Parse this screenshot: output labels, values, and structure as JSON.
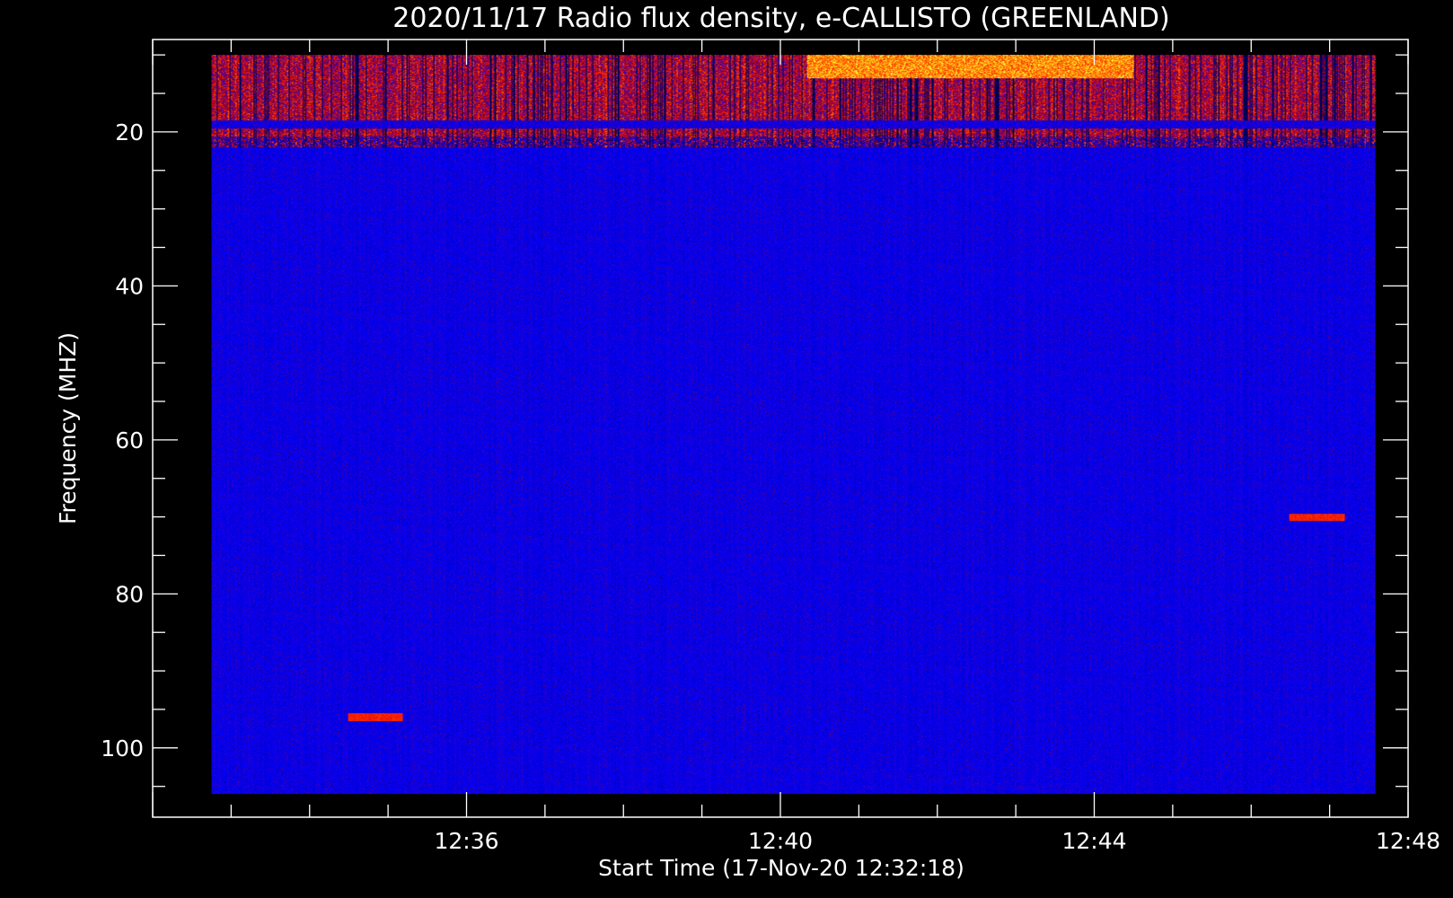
{
  "chart_data": {
    "type": "heatmap",
    "title": "2020/11/17  Radio flux density, e-CALLISTO (GREENLAND)",
    "xlabel": "Start Time (17-Nov-20 12:32:18)",
    "ylabel": "Frequency (MHZ)",
    "x_axis": {
      "unit": "minutes",
      "start_time": "12:32:18",
      "range": [
        "12:32:00",
        "12:48:00"
      ],
      "data_range": [
        "12:32:45",
        "12:47:35"
      ],
      "tick_labels": [
        "12:36",
        "12:40",
        "12:44",
        "12:48"
      ],
      "tick_values_minutes": [
        36,
        40,
        44,
        48
      ],
      "minor_ticks_per_major": 4
    },
    "y_axis": {
      "reversed": true,
      "range": [
        8,
        109
      ],
      "data_range": [
        10,
        106
      ],
      "tick_labels": [
        "20",
        "40",
        "60",
        "80",
        "100"
      ],
      "tick_values": [
        20,
        40,
        60,
        80,
        100
      ],
      "minor_step": 5
    },
    "colormap": [
      "#000000",
      "#0000ff",
      "#c00000",
      "#ff3000",
      "#ff8000",
      "#ffff00"
    ],
    "background_level": "blue",
    "features": [
      {
        "kind": "rfi_band",
        "freq_range_mhz": [
          10,
          22
        ],
        "time_range": [
          "12:32:45",
          "12:47:35"
        ],
        "intensity": "mixed black/red"
      },
      {
        "kind": "strong_emission",
        "freq_range_mhz": [
          10,
          13
        ],
        "time_range": [
          "12:40:20",
          "12:44:30"
        ],
        "intensity": "yellow"
      },
      {
        "kind": "spot",
        "freq_mhz": 96,
        "time": "12:34:50",
        "intensity": "red"
      },
      {
        "kind": "spot",
        "freq_mhz": 70,
        "time": "12:46:50",
        "intensity": "red"
      }
    ]
  }
}
